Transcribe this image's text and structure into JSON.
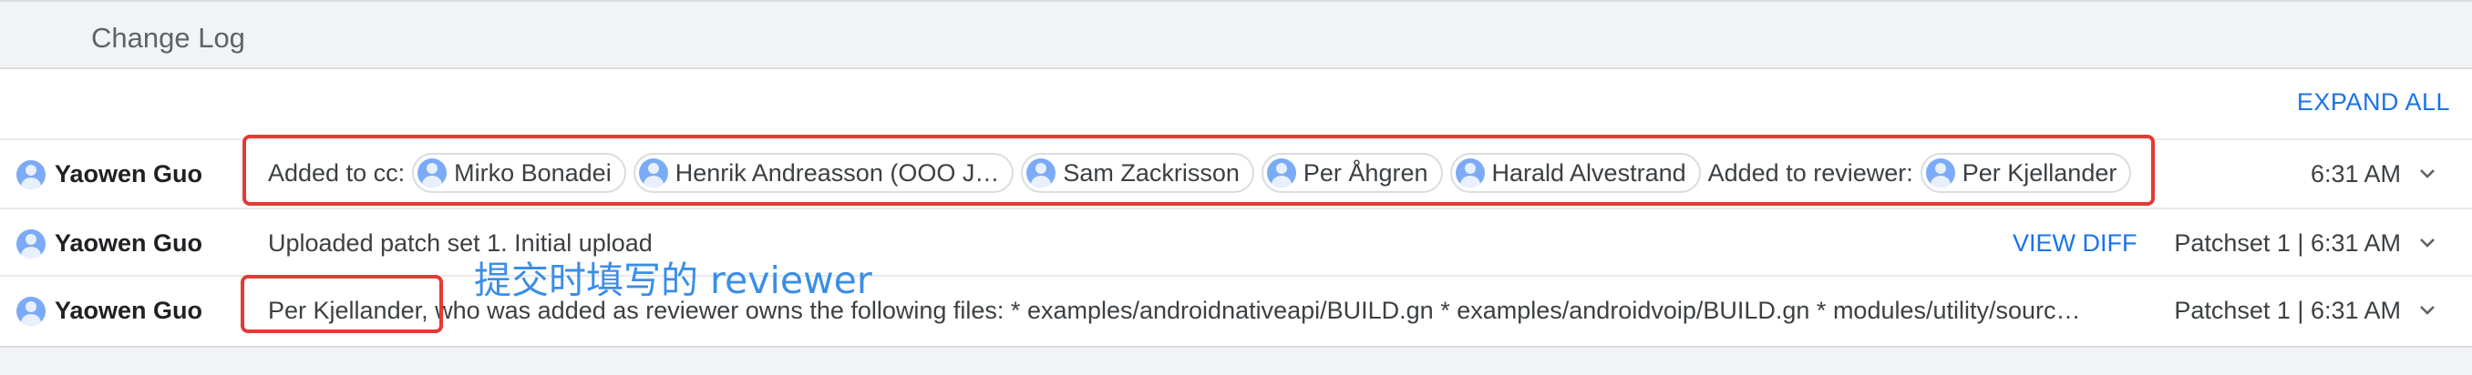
{
  "section": {
    "title": "Change Log"
  },
  "toolbar": {
    "expand_all": "EXPAND ALL"
  },
  "entries": [
    {
      "author": "Yaowen Guo",
      "cc_label": "Added to cc:",
      "cc": [
        "Mirko Bonadei",
        "Henrik Andreasson (OOO J…",
        "Sam Zackrisson",
        "Per Åhgren",
        "Harald Alvestrand"
      ],
      "reviewer_label": "Added to reviewer:",
      "reviewers": [
        "Per Kjellander"
      ],
      "time": "6:31 AM"
    },
    {
      "author": "Yaowen Guo",
      "message": "Uploaded patch set 1. Initial upload",
      "view_diff": "VIEW DIFF",
      "time": "Patchset 1 | 6:31 AM"
    },
    {
      "author": "Yaowen Guo",
      "message": "Per Kjellander, who was added as reviewer owns the following files: * examples/androidnativeapi/BUILD.gn * examples/androidvoip/BUILD.gn * modules/utility/sourc…",
      "time": "Patchset 1 | 6:31 AM"
    }
  ],
  "annotation": {
    "text": "提交时填写的 reviewer"
  },
  "colors": {
    "link": "#1a73e8",
    "highlight": "#e53935",
    "annotation": "#3b8ee6",
    "avatar": "#7baaf7"
  }
}
